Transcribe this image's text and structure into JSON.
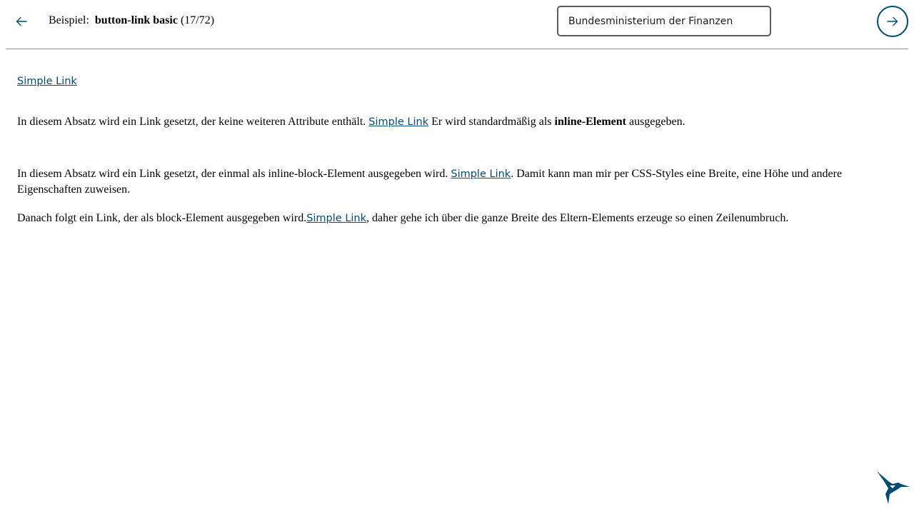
{
  "header": {
    "prefix": "Beispiel:",
    "example_name": "button-link basic",
    "example_counter": "(17/72)",
    "theme_value": "Bundesministerium der Finanzen",
    "prev_icon": "arrow-left-icon",
    "next_icon": "arrow-right-icon"
  },
  "content": {
    "standalone_link": "Simple Link",
    "para_inline": {
      "before": "In diesem Absatz wird ein Link gesetzt, der keine weiteren Attribute enthält. ",
      "link": "Simple Link",
      "middle": " Er wird standardmäßig als ",
      "bold": "inline-Element",
      "after": " ausgegeben."
    },
    "para_inline_block": {
      "before": "In diesem Absatz wird ein Link gesetzt, der einmal als inline-block-Element ausgegeben wird. ",
      "link": "Simple Link",
      "after": ". Damit kann man mir per CSS-Styles eine Breite, eine Höhe und andere Eigenschaften zuweisen."
    },
    "para_block": {
      "before": "Danach folgt ein Link, der als block-Element ausgegeben wird.",
      "link": "Simple Link",
      "after": ", daher gehe ich über die ganze Breite des Eltern-Elements erzeuge so einen Zeilenumbruch."
    }
  },
  "colors": {
    "link": "#004b76",
    "accent": "#004b76",
    "divider": "#8c8c8c"
  },
  "logo_icon": "hummingbird-logo-icon"
}
